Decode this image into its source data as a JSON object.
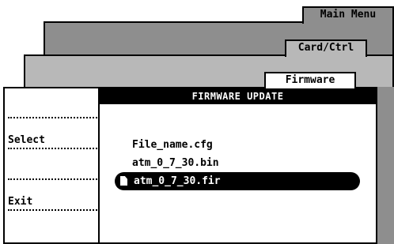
{
  "tabs": {
    "main": "Main Menu",
    "card": "Card/Ctrl",
    "firmware": "Firmware"
  },
  "panel": {
    "title": "FIRMWARE UPDATE"
  },
  "softkeys": [
    {
      "label": ""
    },
    {
      "label": "Select"
    },
    {
      "label": ""
    },
    {
      "label": "Exit"
    }
  ],
  "files": [
    {
      "name": "File_name.cfg",
      "selected": false
    },
    {
      "name": "atm_0_7_30.bin",
      "selected": false
    },
    {
      "name": "atm_0_7_30.fir",
      "selected": true,
      "icon": "document-icon"
    }
  ],
  "colors": {
    "main_layer": "#8e8e8e",
    "card_layer": "#b8b8b8",
    "selection": "#000000"
  }
}
